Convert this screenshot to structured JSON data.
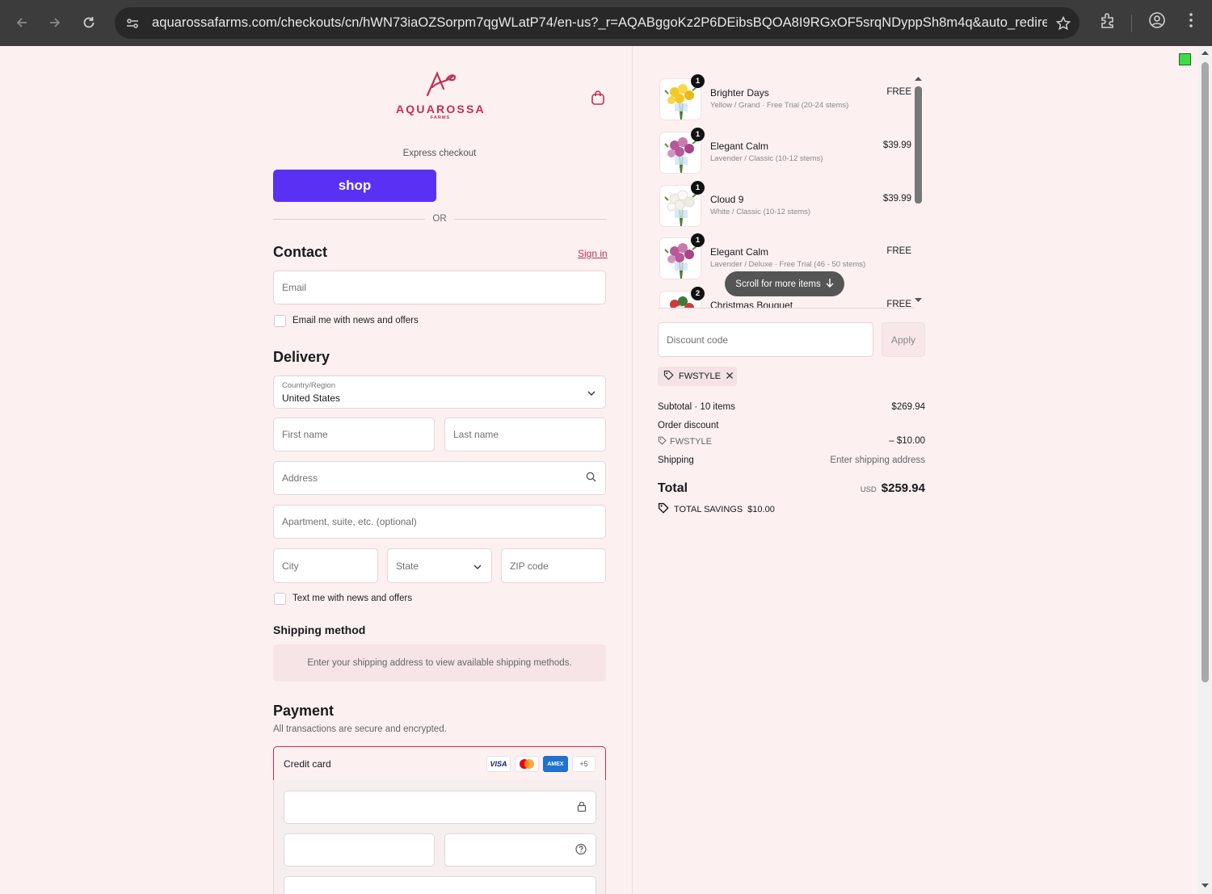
{
  "browser": {
    "url": "aquarossafarms.com/checkouts/cn/hWN73iaOZSorpm7qgWLatP74/en-us?_r=AQABggoKz2P6DEibsBQOA8I9RGxOF5srqNDyppSh8m4q&auto_redirect..."
  },
  "brand": {
    "name": "AQUAROSSA",
    "sub": "FARMS",
    "accent": "#c0304f"
  },
  "express": {
    "label": "Express checkout",
    "shop_label": "shop",
    "or_label": "OR"
  },
  "contact": {
    "title": "Contact",
    "sign_in": "Sign in",
    "email_placeholder": "Email",
    "news_checkbox": "Email me with news and offers"
  },
  "delivery": {
    "title": "Delivery",
    "country_label": "Country/Region",
    "country_value": "United States",
    "first_name": "First name",
    "last_name": "Last name",
    "address": "Address",
    "apartment": "Apartment, suite, etc. (optional)",
    "city": "City",
    "state": "State",
    "zip": "ZIP code",
    "text_checkbox": "Text me with news and offers"
  },
  "shipping_method": {
    "title": "Shipping method",
    "note": "Enter your shipping address to view available shipping methods."
  },
  "payment": {
    "title": "Payment",
    "subtitle": "All transactions are secure and encrypted.",
    "method": "Credit card",
    "cards": [
      "VISA",
      "MC",
      "AMEX",
      "+5"
    ]
  },
  "cart": {
    "items": [
      {
        "qty": "1",
        "name": "Brighter Days",
        "variant": "Yellow / Grand · Free Trial (20-24 stems)",
        "price": "FREE",
        "color": "#f0c829"
      },
      {
        "qty": "1",
        "name": "Elegant Calm",
        "variant": "Lavender / Classic (10-12 stems)",
        "price": "$39.99",
        "color": "#b9589a"
      },
      {
        "qty": "1",
        "name": "Cloud 9",
        "variant": "White / Classic (10-12 stems)",
        "price": "$39.99",
        "color": "#f4f1e6"
      },
      {
        "qty": "1",
        "name": "Elegant Calm",
        "variant": "Lavender / Deluxe · Free Trial (46 - 50 stems)",
        "price": "FREE",
        "color": "#b9589a"
      },
      {
        "qty": "2",
        "name": "Christmas Bouquet",
        "variant": "",
        "price": "FREE",
        "color": "#d23a3a"
      }
    ],
    "scroll_hint": "Scroll for more items",
    "discount_placeholder": "Discount code",
    "apply_label": "Apply",
    "applied_code": "FWSTYLE"
  },
  "summary": {
    "subtotal_label": "Subtotal · 10 items",
    "subtotal_value": "$269.94",
    "order_discount_label": "Order discount",
    "discount_code": "FWSTYLE",
    "discount_value": "– $10.00",
    "shipping_label": "Shipping",
    "shipping_value": "Enter shipping address",
    "total_label": "Total",
    "currency": "USD",
    "total_value": "$259.94",
    "savings_label": "TOTAL SAVINGS",
    "savings_value": "$10.00"
  }
}
